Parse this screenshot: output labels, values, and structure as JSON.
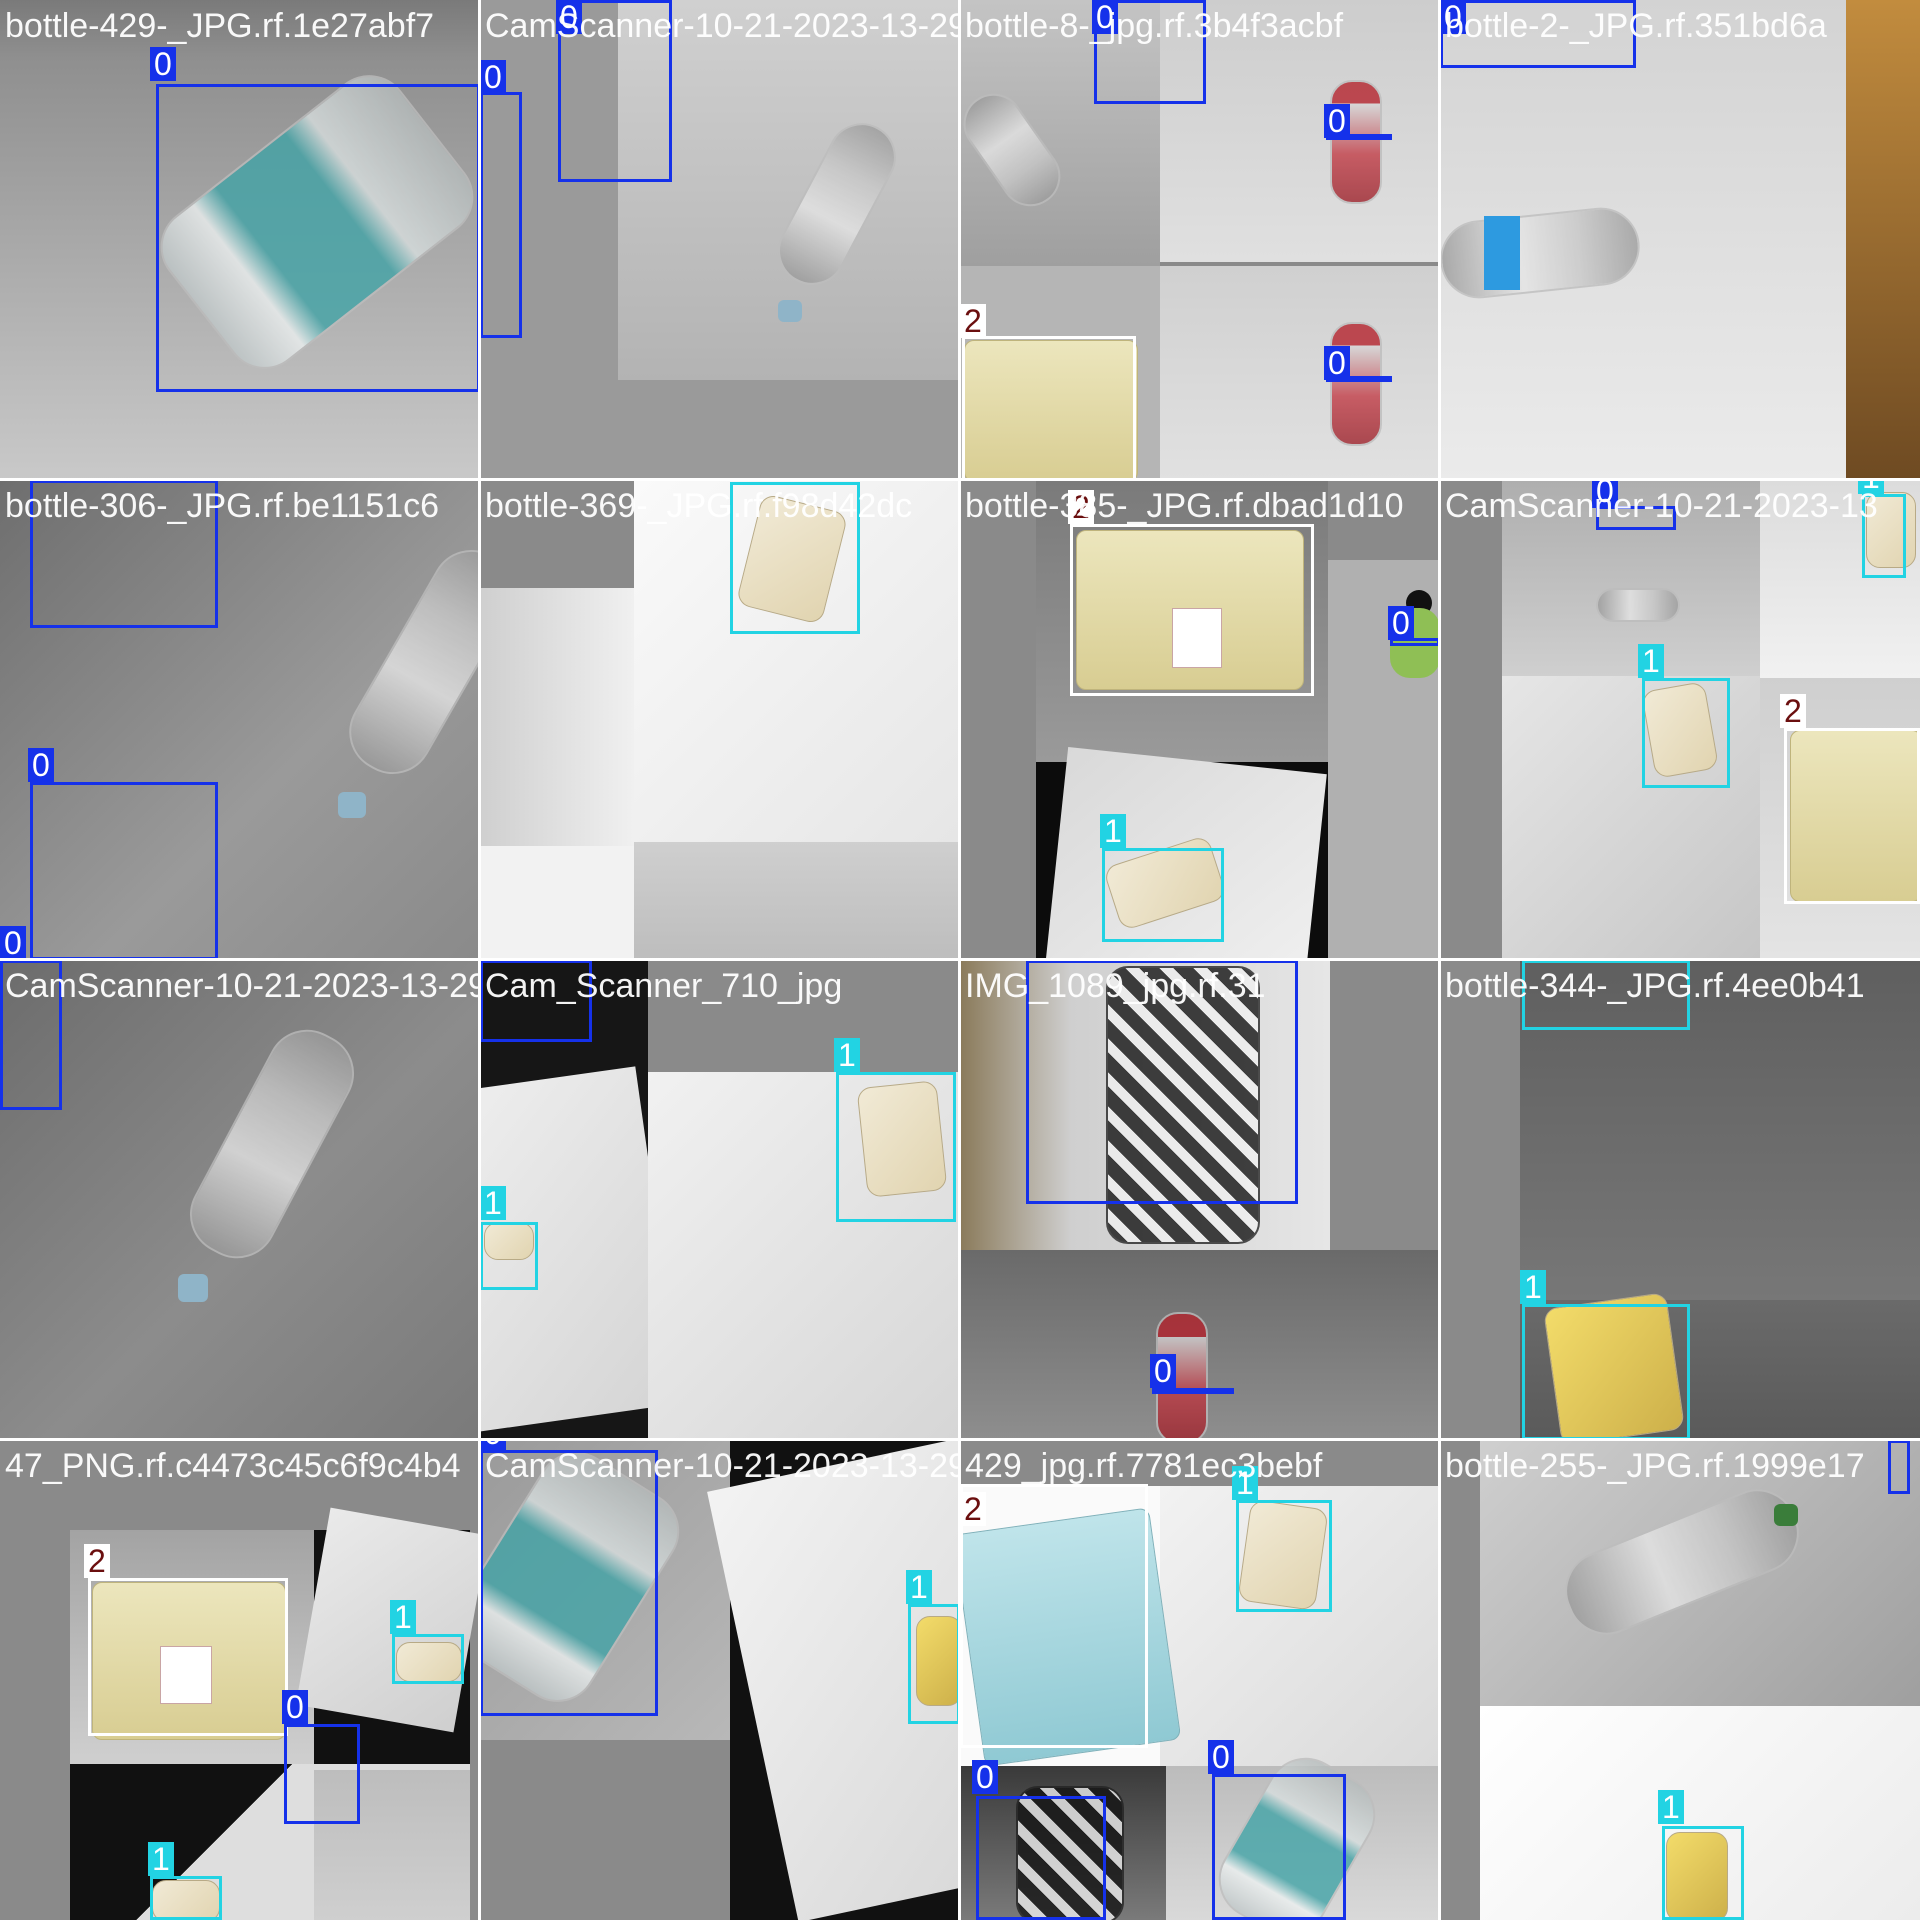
{
  "mosaic": {
    "class_colors": {
      "0": "#1531ea",
      "1": "#22d3e3",
      "2": "#ffffff"
    },
    "class_label_text_colors": {
      "0": "#ffffff",
      "1": "#ffffff",
      "2": "#6b0f0f"
    },
    "tiles": [
      {
        "filename": "bottle-429-_JPG.rf.1e27abf7",
        "labels": [
          "0",
          "0"
        ]
      },
      {
        "filename": "CamScanner-10-21-2023-13-29",
        "labels": [
          "0",
          "0"
        ]
      },
      {
        "filename": "bottle-8-_jpg.rf.3b4f3acbf",
        "labels": [
          "0",
          "0",
          "0",
          "2"
        ]
      },
      {
        "filename": "bottle-2-_JPG.rf.351bd6a",
        "labels": [
          "0"
        ]
      },
      {
        "filename": "bottle-306-_JPG.rf.be1151c6",
        "labels": [
          "0",
          "0",
          "0"
        ]
      },
      {
        "filename": "bottle-369-_JPG.rf.f98d42dc",
        "labels": [
          "1"
        ]
      },
      {
        "filename": "bottle-385-_JPG.rf.dbad1d10",
        "labels": [
          "2",
          "0",
          "1"
        ]
      },
      {
        "filename": "CamScanner-10-21-2023-13",
        "labels": [
          "0",
          "1",
          "1",
          "2"
        ]
      },
      {
        "filename": "CamScanner-10-21-2023-13-29",
        "labels": [
          "0"
        ]
      },
      {
        "filename": "Cam_Scanner_710_jpg",
        "labels": [
          "0",
          "1",
          "1"
        ]
      },
      {
        "filename": "IMG_1089_jpg.rf.31",
        "labels": [
          "0",
          "0"
        ]
      },
      {
        "filename": "bottle-344-_JPG.rf.4ee0b41",
        "labels": [
          "1",
          "1"
        ]
      },
      {
        "filename": "47_PNG.rf.c4473c45c6f9c4b4",
        "labels": [
          "2",
          "1",
          "0",
          "1"
        ]
      },
      {
        "filename": "CamScanner-10-21-2023-13-29",
        "labels": [
          "0",
          "1"
        ]
      },
      {
        "filename": "429_jpg.rf.7781ec3bebf",
        "labels": [
          "2",
          "1",
          "0",
          "0"
        ]
      },
      {
        "filename": "bottle-255-_JPG.rf.1999e17",
        "labels": [
          "0",
          "1"
        ]
      }
    ]
  }
}
